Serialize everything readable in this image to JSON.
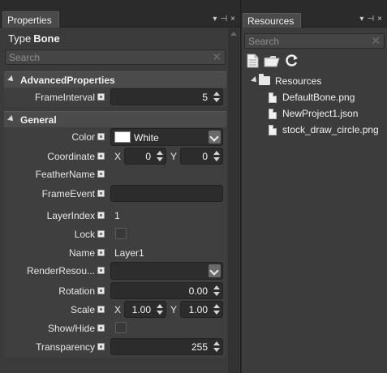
{
  "properties_panel": {
    "tab_label": "Properties",
    "type_label": "Type",
    "type_value": "Bone",
    "search_placeholder": "Search",
    "sections": {
      "advanced": {
        "title": "AdvancedProperties",
        "frame_interval": {
          "label": "FrameInterval",
          "value": "5"
        }
      },
      "general": {
        "title": "General",
        "color": {
          "label": "Color",
          "value": "White",
          "swatch": "#ffffff"
        },
        "coordinate": {
          "label": "Coordinate",
          "x_label": "X",
          "x_value": "0",
          "y_label": "Y",
          "y_value": "0"
        },
        "feather_name": {
          "label": "FeatherName"
        },
        "frame_event": {
          "label": "FrameEvent",
          "value": ""
        },
        "layer_index": {
          "label": "LayerIndex",
          "value": "1"
        },
        "lock": {
          "label": "Lock",
          "checked": false
        },
        "name": {
          "label": "Name",
          "value": "Layer1"
        },
        "render_resource": {
          "label": "RenderResou...",
          "value": ""
        },
        "rotation": {
          "label": "Rotation",
          "value": "0.00"
        },
        "scale": {
          "label": "Scale",
          "x_label": "X",
          "x_value": "1.00",
          "y_label": "Y",
          "y_value": "1.00"
        },
        "show_hide": {
          "label": "Show/Hide",
          "checked": false
        },
        "transparency": {
          "label": "Transparency",
          "value": "255"
        }
      }
    }
  },
  "resources_panel": {
    "tab_label": "Resources",
    "search_placeholder": "Search",
    "toolbar": [
      "new-file-icon",
      "open-folder-icon",
      "refresh-icon"
    ],
    "tree": {
      "root": "Resources",
      "files": [
        "DefaultBone.png",
        "NewProject1.json",
        "stock_draw_circle.png"
      ]
    }
  },
  "tab_icons": {
    "dropdown": "▾",
    "pin": "⊣",
    "close": "×"
  }
}
